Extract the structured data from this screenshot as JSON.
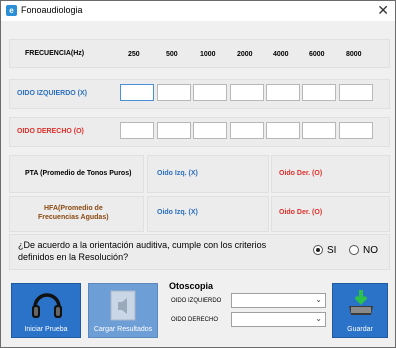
{
  "window": {
    "title": "Fonoaudiologia",
    "app_icon_glyph": "e",
    "close_label": "✕"
  },
  "frequency": {
    "label": "FRECUENCIA(Hz)",
    "values": [
      "250",
      "500",
      "1000",
      "2000",
      "4000",
      "6000",
      "8000"
    ]
  },
  "left_ear": {
    "label": "OIDO IZQUIERDO (X)",
    "values": [
      "",
      "",
      "",
      "",
      "",
      "",
      ""
    ]
  },
  "right_ear": {
    "label": "OIDO DERECHO (O)",
    "values": [
      "",
      "",
      "",
      "",
      "",
      "",
      ""
    ]
  },
  "pta": {
    "label": "PTA (Promedio de Tonos Puros)",
    "left": "Oido Izq. (X)",
    "right": "Oido Der. (O)"
  },
  "hfa": {
    "label_line1": "HFA(Promedio de",
    "label_line2": "Frecuencias Agudas)",
    "left": "Oido Izq. (X)",
    "right": "Oido Der. (O)"
  },
  "question": {
    "text": "¿De acuerdo a la orientación auditiva, cumple con los criterios definidos en la Resolución?",
    "yes": "SI",
    "no": "NO",
    "selected": "SI"
  },
  "buttons": {
    "start": "Iniciar Prueba",
    "load": "Cargar Resultados",
    "save": "Guardar"
  },
  "otoscopia": {
    "title": "Otoscopia",
    "left_label": "OIDO IZQUIERDO",
    "right_label": "OIDO DERECHO",
    "left_value": "",
    "right_value": ""
  },
  "colors": {
    "accent_blue": "#2b6fc2",
    "accent_red": "#e0302a",
    "button_blue": "#2b73c9"
  }
}
